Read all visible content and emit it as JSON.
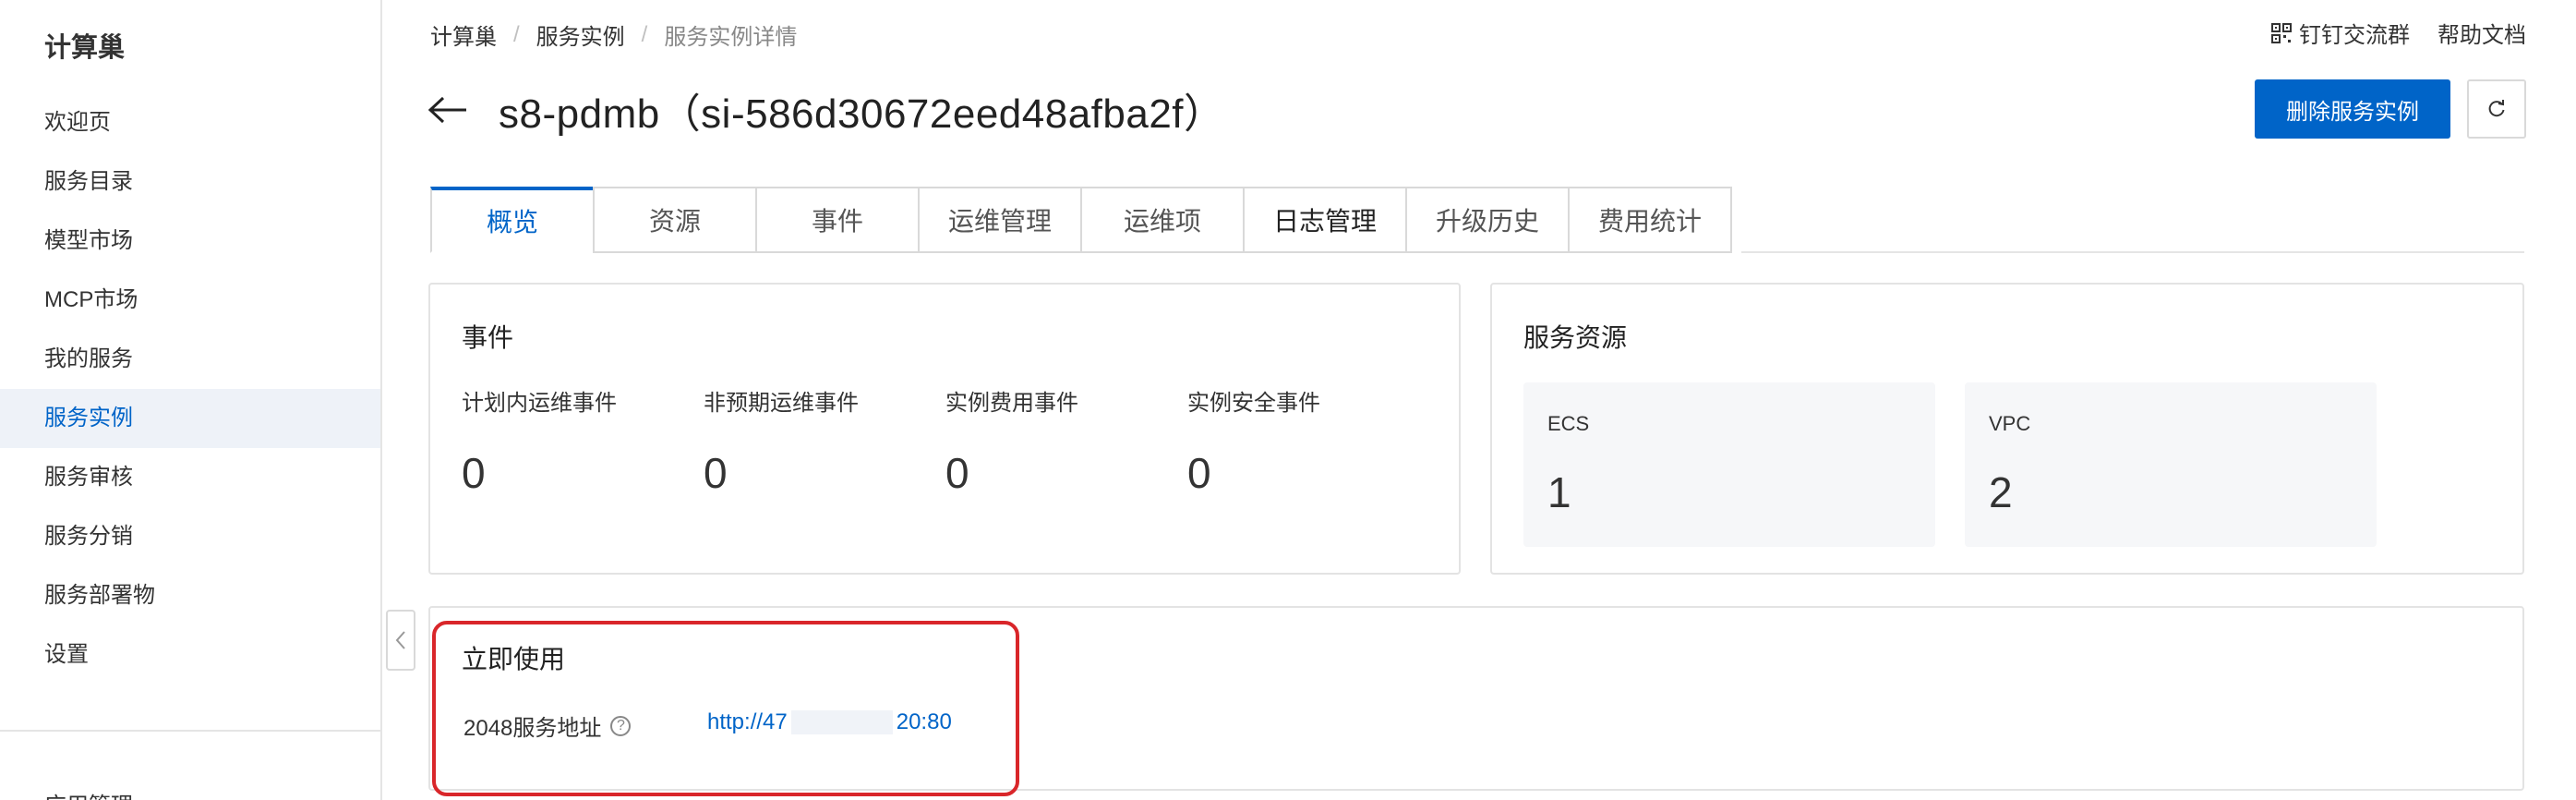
{
  "sidebar": {
    "title": "计算巢",
    "items": [
      {
        "label": "欢迎页"
      },
      {
        "label": "服务目录"
      },
      {
        "label": "模型市场"
      },
      {
        "label": "MCP市场"
      },
      {
        "label": "我的服务"
      },
      {
        "label": "服务实例",
        "active": true
      },
      {
        "label": "服务审核"
      },
      {
        "label": "服务分销"
      },
      {
        "label": "服务部署物"
      },
      {
        "label": "设置"
      }
    ],
    "bottom_partial": "应用管理"
  },
  "breadcrumb": [
    "计算巢",
    "服务实例",
    "服务实例详情"
  ],
  "top_links": {
    "dingtalk": "钉钉交流群",
    "help": "帮助文档"
  },
  "page": {
    "title": "s8-pdmb（si-586d30672eed48afba2f）"
  },
  "actions": {
    "delete_label": "删除服务实例"
  },
  "tabs": [
    {
      "label": "概览",
      "active": true
    },
    {
      "label": "资源"
    },
    {
      "label": "事件"
    },
    {
      "label": "运维管理"
    },
    {
      "label": "运维项"
    },
    {
      "label": "日志管理"
    },
    {
      "label": "升级历史"
    },
    {
      "label": "费用统计"
    }
  ],
  "events": {
    "title": "事件",
    "items": [
      {
        "label": "计划内运维事件",
        "value": "0"
      },
      {
        "label": "非预期运维事件",
        "value": "0"
      },
      {
        "label": "实例费用事件",
        "value": "0"
      },
      {
        "label": "实例安全事件",
        "value": "0"
      }
    ]
  },
  "resources": {
    "title": "服务资源",
    "items": [
      {
        "label": "ECS",
        "value": "1"
      },
      {
        "label": "VPC",
        "value": "2"
      }
    ]
  },
  "use_now": {
    "title": "立即使用",
    "address_label": "2048服务地址",
    "link_start": "http://47",
    "link_end": "20:80"
  },
  "colors": {
    "accent": "#0064c8",
    "highlight": "#d9262a"
  }
}
